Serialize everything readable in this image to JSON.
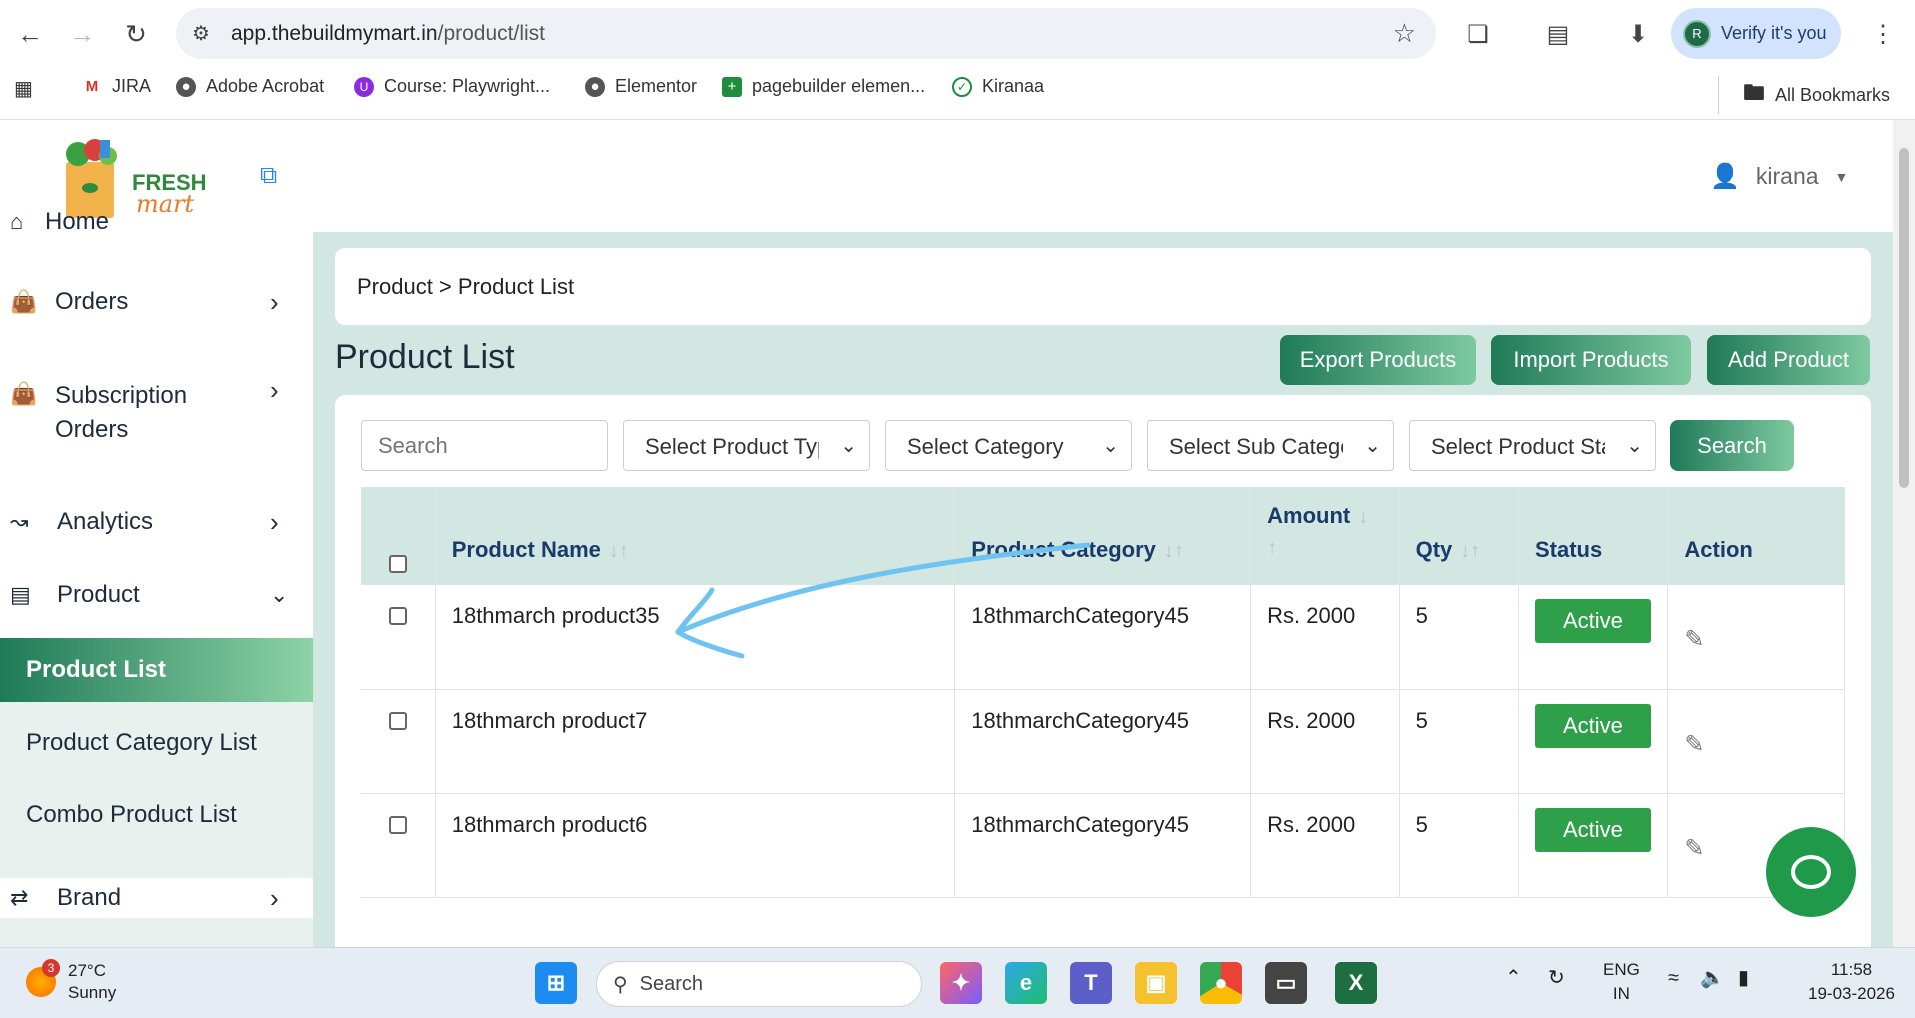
{
  "browser": {
    "url_host": "app.thebuildmymart.in",
    "url_path": "/product/list",
    "verify_label": "Verify it's you",
    "profile_initial": "R",
    "bookmarks": [
      {
        "label": "JIRA",
        "icon": "gmail-icon"
      },
      {
        "label": "Adobe Acrobat",
        "icon": "globe-icon"
      },
      {
        "label": "Course: Playwright...",
        "icon": "udemy-icon"
      },
      {
        "label": "Elementor",
        "icon": "globe-icon"
      },
      {
        "label": "pagebuilder elemen...",
        "icon": "sheets-icon"
      },
      {
        "label": "Kiranaa",
        "icon": "check-icon"
      }
    ],
    "all_bookmarks": "All Bookmarks"
  },
  "sidebar": {
    "logo_line1": "FRESH",
    "logo_line2": "mart",
    "items": [
      {
        "label": "Home",
        "icon": "home-icon"
      },
      {
        "label": "Orders",
        "icon": "bag-icon"
      },
      {
        "label": "Subscription Orders",
        "icon": "bag-icon"
      },
      {
        "label": "Analytics",
        "icon": "chart-icon"
      },
      {
        "label": "Product",
        "icon": "box-icon"
      },
      {
        "label": "Brand",
        "icon": "shuffle-icon"
      }
    ],
    "product_submenu": [
      "Product List",
      "Product Category List",
      "Combo Product List"
    ]
  },
  "header": {
    "username": "kirana"
  },
  "breadcrumb": "Product > Product List",
  "page_title": "Product List",
  "buttons": {
    "export": "Export Products",
    "import": "Import Products",
    "add": "Add Product",
    "search": "Search"
  },
  "filters": {
    "search_placeholder": "Search",
    "product_type": "Select Product Type",
    "category": "Select Category",
    "sub_category": "Select Sub Category",
    "product_status": "Select Product Status"
  },
  "table": {
    "headers": [
      "Product Name",
      "Product Category",
      "Amount",
      "Qty",
      "Status",
      "Action"
    ],
    "rows": [
      {
        "name": "18thmarch product35",
        "category": "18thmarchCategory45",
        "amount": "Rs. 2000",
        "qty": "5",
        "status": "Active"
      },
      {
        "name": "18thmarch product7",
        "category": "18thmarchCategory45",
        "amount": "Rs. 2000",
        "qty": "5",
        "status": "Active"
      },
      {
        "name": "18thmarch product6",
        "category": "18thmarchCategory45",
        "amount": "Rs. 2000",
        "qty": "5",
        "status": "Active"
      }
    ]
  },
  "taskbar": {
    "temperature": "27°C",
    "weather": "Sunny",
    "weather_badge": "3",
    "search_label": "Search",
    "lang1": "ENG",
    "lang2": "IN",
    "time": "11:58",
    "date": "19-03-2026"
  },
  "colors": {
    "accent_dark": "#1f7a58",
    "accent_light": "#7ec9a0",
    "status_active": "#2fa04a",
    "main_bg": "#d2e7e2"
  }
}
